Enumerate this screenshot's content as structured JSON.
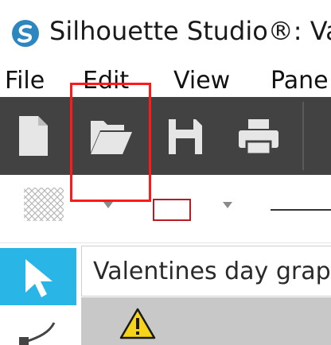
{
  "window": {
    "title": "Silhouette Studio®: Va",
    "logo_icon": "silhouette-s-logo-icon"
  },
  "menu": {
    "items": [
      {
        "label": "File"
      },
      {
        "label": "Edit"
      },
      {
        "label": "View"
      },
      {
        "label": "Pane"
      }
    ]
  },
  "toolbar": {
    "buttons": [
      {
        "name": "new-document-button",
        "icon": "file-icon"
      },
      {
        "name": "open-folder-button",
        "icon": "folder-open-icon"
      },
      {
        "name": "save-button",
        "icon": "floppy-disk-icon"
      },
      {
        "name": "print-button",
        "icon": "printer-icon"
      }
    ],
    "background": "#424242"
  },
  "style_bar": {
    "fill_pattern_icon": "crosshatch-pattern-icon",
    "line_color": "#b51c24"
  },
  "tools": {
    "selected": "select-pointer-icon",
    "accent": "#29b6e6"
  },
  "document": {
    "tab_label": "Valentines day grap"
  },
  "canvas": {
    "warning_icon": "warning-triangle-icon",
    "background": "#c8c8c8"
  },
  "annotation": {
    "highlight_color": "#ff1a1a"
  }
}
